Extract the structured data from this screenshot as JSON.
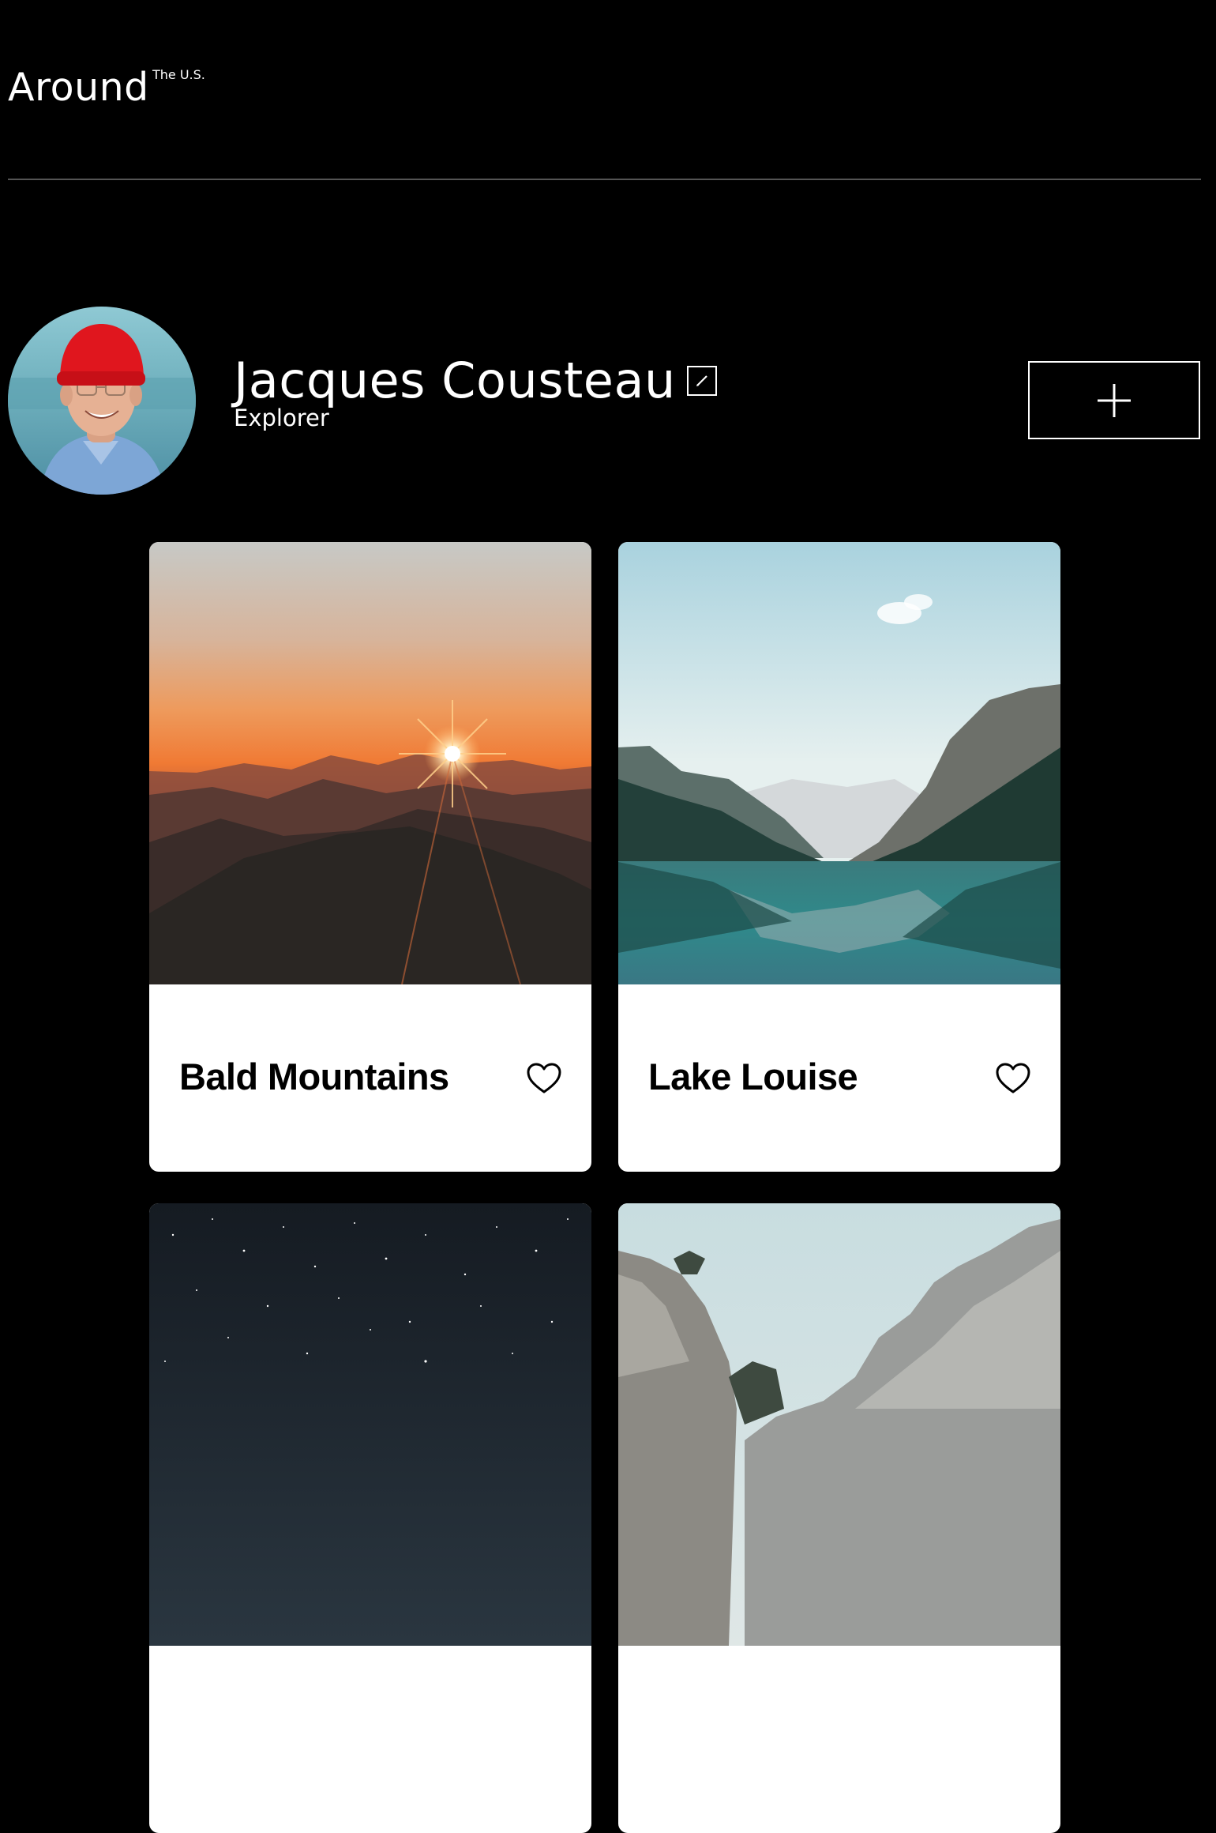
{
  "header": {
    "logo_main": "Around",
    "logo_sup": "The U.S."
  },
  "profile": {
    "name": "Jacques Cousteau",
    "job": "Explorer",
    "edit_icon": "pencil-edit-icon",
    "add_icon": "plus-icon",
    "avatar_icon": "avatar"
  },
  "cards": [
    {
      "title": "Bald Mountains",
      "image": "sunset-over-mountains",
      "like_icon": "heart-outline-icon"
    },
    {
      "title": "Lake Louise",
      "image": "mountain-lake-reflection",
      "like_icon": "heart-outline-icon"
    },
    {
      "title": "",
      "image": "starry-night-sky",
      "like_icon": "heart-outline-icon"
    },
    {
      "title": "",
      "image": "rocky-mountain-cliffs",
      "like_icon": "heart-outline-icon"
    }
  ],
  "colors": {
    "background": "#000000",
    "divider": "#545454",
    "card_bg": "#ffffff",
    "text_primary": "#ffffff",
    "card_text": "#000000"
  }
}
